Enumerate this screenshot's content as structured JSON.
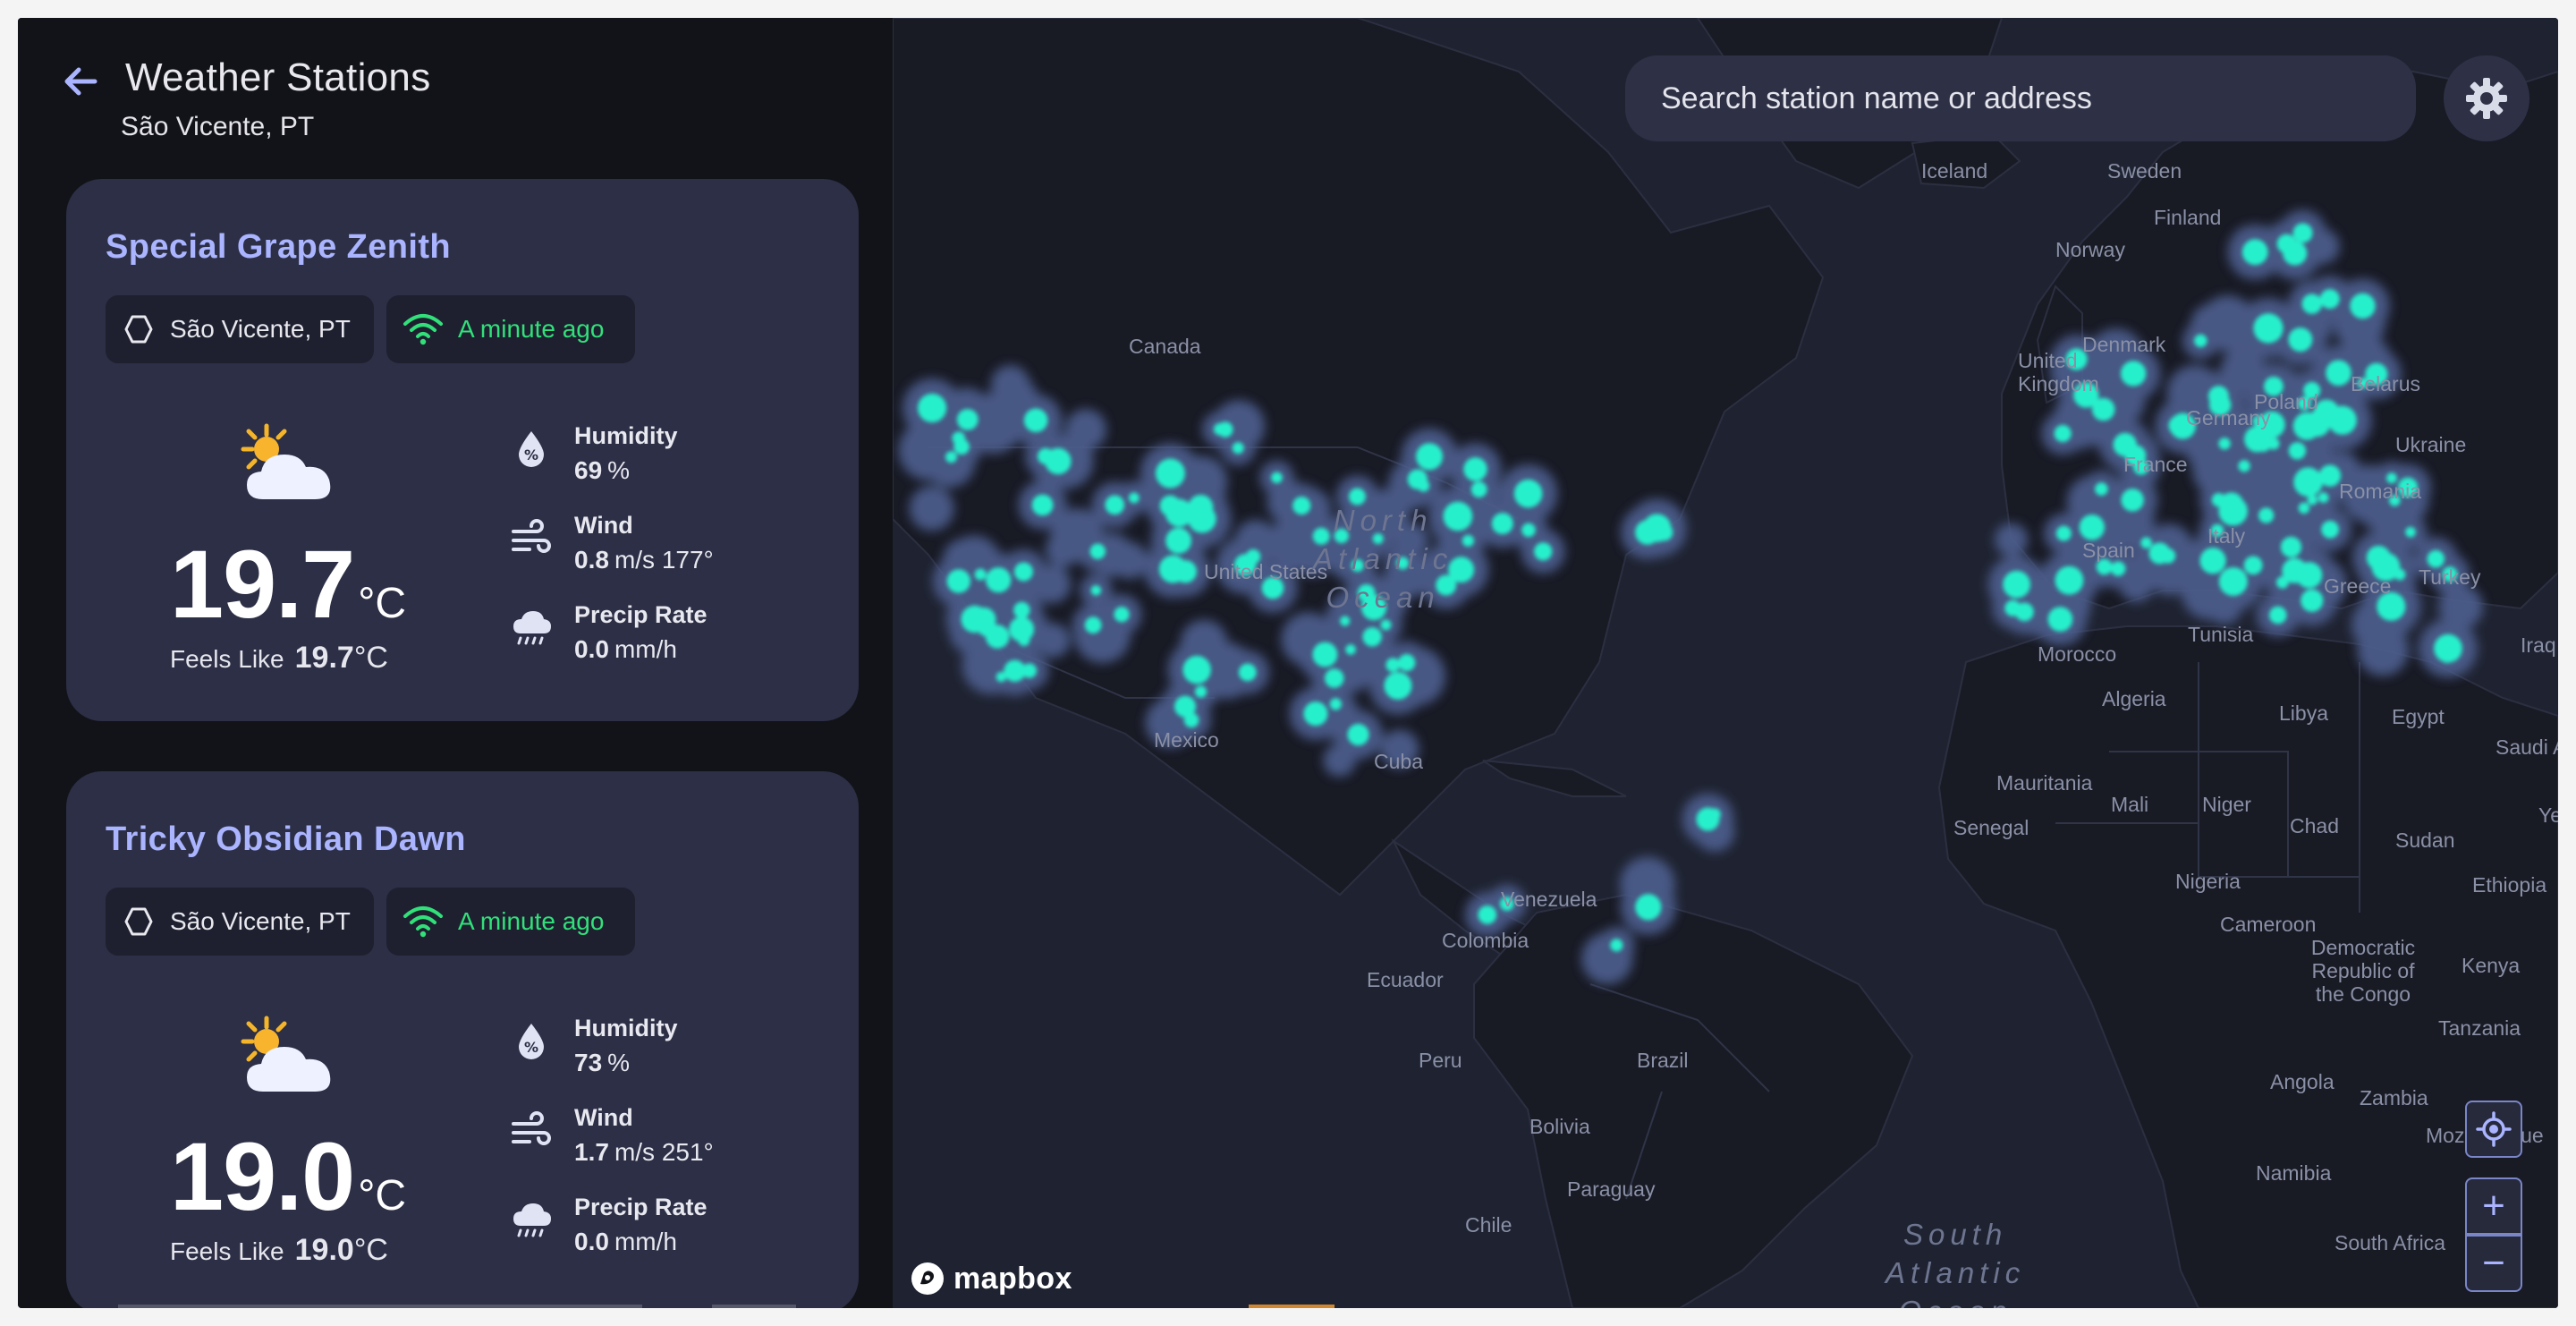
{
  "header": {
    "title": "Weather Stations",
    "subtitle": "São Vicente, PT"
  },
  "stations": [
    {
      "name": "Special Grape Zenith",
      "location": "São Vicente, PT",
      "status": "A minute ago",
      "temperature": "19.7",
      "temperature_unit": "°C",
      "feels_like_label": "Feels Like",
      "feels_like": "19.7",
      "feels_like_unit": "°C",
      "humidity_label": "Humidity",
      "humidity": "69",
      "humidity_unit": "%",
      "wind_label": "Wind",
      "wind_speed": "0.8",
      "wind_unit": "m/s 177°",
      "precip_label": "Precip Rate",
      "precip": "0.0",
      "precip_unit": "mm/h"
    },
    {
      "name": "Tricky Obsidian Dawn",
      "location": "São Vicente, PT",
      "status": "A minute ago",
      "temperature": "19.0",
      "temperature_unit": "°C",
      "feels_like_label": "Feels Like",
      "feels_like": "19.0",
      "feels_like_unit": "°C",
      "humidity_label": "Humidity",
      "humidity": "73",
      "humidity_unit": "%",
      "wind_label": "Wind",
      "wind_speed": "1.7",
      "wind_unit": "m/s 251°",
      "precip_label": "Precip Rate",
      "precip": "0.0",
      "precip_unit": "mm/h"
    }
  ],
  "map": {
    "search_placeholder": "Search station name or address",
    "attribution": "mapbox",
    "labels": [
      "Iceland",
      "Sweden",
      "Finland",
      "Norway",
      "Denmark",
      "United Kingdom",
      "Belarus",
      "Poland",
      "Germany",
      "Ukraine",
      "France",
      "Romania",
      "Italy",
      "Spain",
      "Greece",
      "Turkey",
      "Tunisia",
      "Morocco",
      "Iraq",
      "Algeria",
      "Libya",
      "Egypt",
      "Saudi Ar",
      "Mauritania",
      "Mali",
      "Niger",
      "Chad",
      "Sudan",
      "Senegal",
      "Ye",
      "Nigeria",
      "Ethiopia",
      "Cameroon",
      "Democratic Republic of the Congo",
      "Kenya",
      "Tanzania",
      "Angola",
      "Zambia",
      "Mozambique",
      "Namibia",
      "South Africa",
      "Canada",
      "United States",
      "Mexico",
      "Cuba",
      "Venezuela",
      "Colombia",
      "Ecuador",
      "Peru",
      "Brazil",
      "Bolivia",
      "Paraguay",
      "Chile"
    ],
    "oceans": [
      "North Atlantic Ocean",
      "South Atlantic Ocean"
    ],
    "zoom_in_label": "+",
    "zoom_out_label": "−"
  },
  "colors": {
    "accent": "#aab4ff",
    "online": "#32e07a",
    "heat": "#27f0cc",
    "card": "#2c2f45"
  },
  "icons": {
    "back": "arrow-left-icon",
    "location": "hexagon-icon",
    "status": "wifi-icon",
    "weather": "partly-sunny-icon",
    "humidity": "drop-percent-icon",
    "wind": "wind-icon",
    "precip": "rain-cloud-icon",
    "settings": "gear-icon",
    "locate": "crosshair-icon"
  }
}
